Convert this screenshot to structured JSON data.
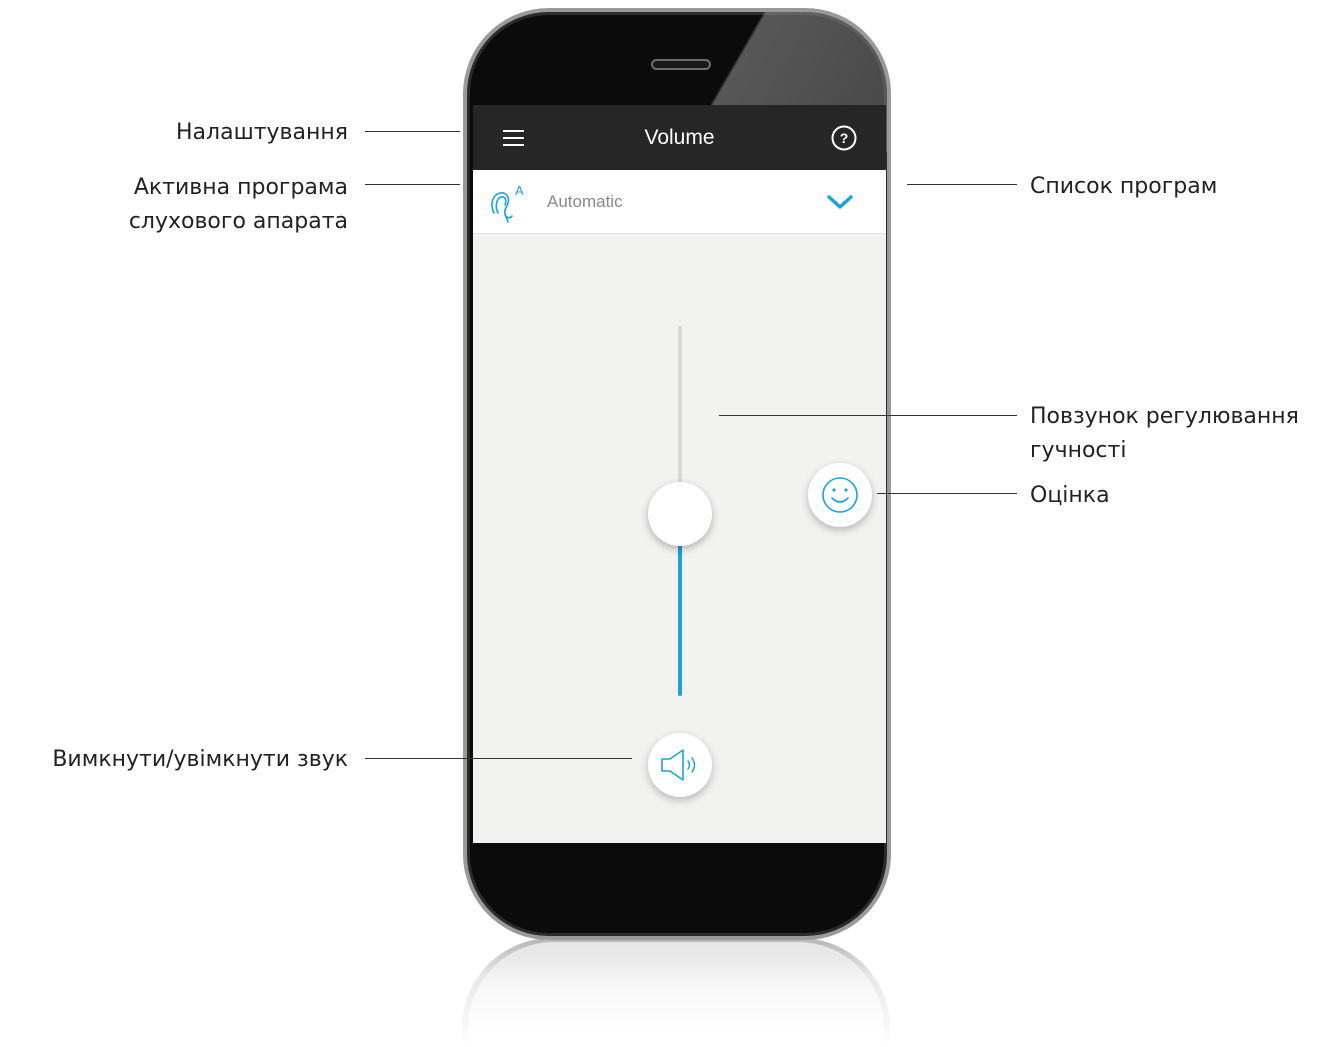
{
  "app": {
    "title": "Volume",
    "accent_color": "#1aa3dd",
    "topbar_color": "#262626",
    "screen_background": "#f2f2f1"
  },
  "topbar": {
    "menu_icon": "hamburger-menu-icon",
    "help_icon": "question-circle-icon"
  },
  "program": {
    "icon": "hearing-aid-automatic-icon",
    "icon_badge": "A",
    "label": "Automatic",
    "dropdown_icon": "chevron-down-icon"
  },
  "volume": {
    "level_percent": 50,
    "rating_icon": "smiley-face-icon",
    "mute_icon": "speaker-icon"
  },
  "annotations": {
    "settings": "Налаштування",
    "active_program_line1": "Активна програма",
    "active_program_line2": "слухового апарата",
    "program_list": "Список програм",
    "volume_slider_line1": "Повзунок регулювання",
    "volume_slider_line2": "гучності",
    "rating": "Оцінка",
    "mute": "Вимкнути/увімкнути звук"
  }
}
